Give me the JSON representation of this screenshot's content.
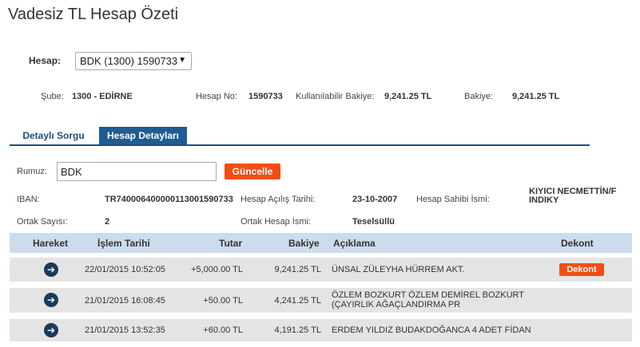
{
  "page_title": "Vadesiz TL Hesap Özeti",
  "account": {
    "label": "Hesap:",
    "selected": "BDK (1300) 1590733"
  },
  "info": {
    "sube_label": "Şube:",
    "sube_value": "1300 - EDİRNE",
    "hesap_no_label": "Hesap No:",
    "hesap_no_value": "1590733",
    "kullanilabilir_label": "Kullanılabilir Bakiye:",
    "kullanilabilir_value": "9,241.25 TL",
    "bakiye_label": "Bakiye:",
    "bakiye_value": "9,241.25 TL"
  },
  "tabs": [
    {
      "label": "Detaylı Sorgu"
    },
    {
      "label": "Hesap Detayları"
    }
  ],
  "form": {
    "rumuz_label": "Rumuz:",
    "rumuz_value": "BDK",
    "update_label": "Güncelle",
    "iban_label": "IBAN:",
    "iban_value": "TR740006400000113001590733",
    "acilis_label": "Hesap Açılış Tarihi:",
    "acilis_value": "23-10-2007",
    "sahibi_label": "Hesap Sahibi İsmi:",
    "sahibi_value": "KIYICI NECMETTİN/FINDIKY",
    "ortak_sayisi_label": "Ortak Sayısı:",
    "ortak_sayisi_value": "2",
    "ortak_isim_label": "Ortak Hesap İsmi:",
    "ortak_isim_value": "Teselsüllü"
  },
  "table": {
    "headers": {
      "hareket": "Hareket",
      "tarih": "İşlem Tarihi",
      "tutar": "Tutar",
      "bakiye": "Bakiye",
      "aciklama": "Açıklama",
      "dekont": "Dekont"
    },
    "rows": [
      {
        "tarih": "22/01/2015 10:52:05",
        "tutar": "+5,000.00 TL",
        "bakiye": "9,241.25 TL",
        "aciklama": "ÜNSAL ZÜLEYHA HÜRREM AKT.",
        "dekont": "Dekont"
      },
      {
        "tarih": "21/01/2015 16:08:45",
        "tutar": "+50.00 TL",
        "bakiye": "4,241.25 TL",
        "aciklama": "ÖZLEM BOZKURT ÖZLEM DEMİREL BOZKURT (ÇAYIRLIK AĞAÇLANDIRMA PR"
      },
      {
        "tarih": "21/01/2015 13:52:35",
        "tutar": "+60.00 TL",
        "bakiye": "4,191.25 TL",
        "aciklama": "ERDEM YILDIZ BUDAKDOĞANCA 4 ADET FİDAN"
      }
    ]
  },
  "icons": {
    "select_caret": "▼",
    "row_arrow": "➔"
  },
  "colors": {
    "accent": "#f04e14",
    "tab_active": "#1f5c94",
    "header_bg": "#ccdcec",
    "row_bg": "#e4e4e4"
  }
}
